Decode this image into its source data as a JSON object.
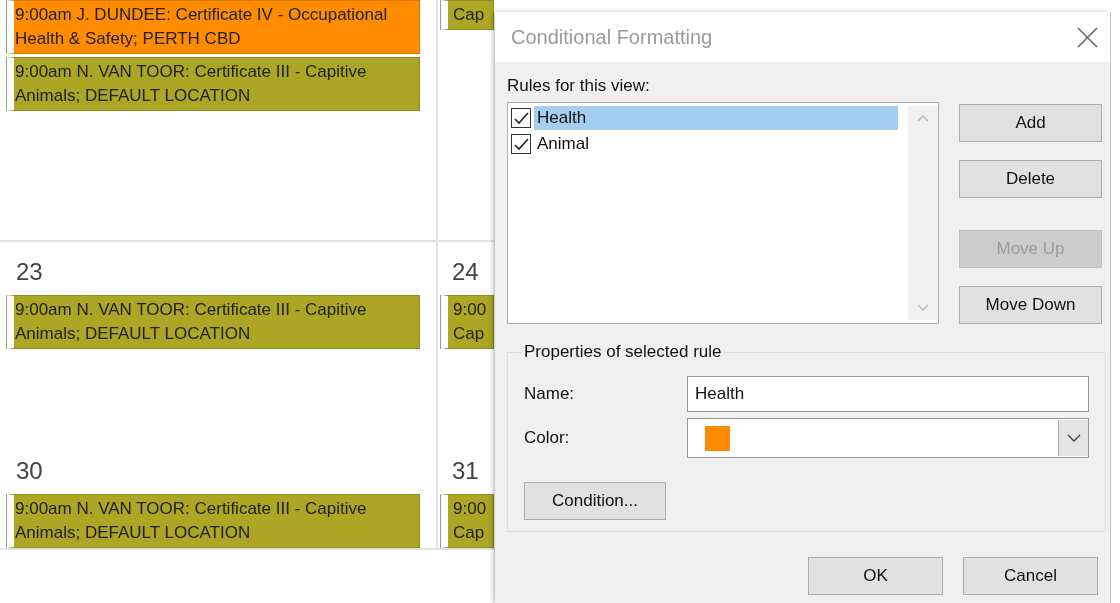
{
  "calendar": {
    "weeks": [
      {
        "days": [
          {
            "events": [
              {
                "text": "9:00am J. DUNDEE: Certificate IV - Occupational Health & Safety; PERTH CBD",
                "color": "#ff8c00"
              },
              {
                "text": "9:00am N. VAN TOOR: Certificate III - Capitive Animals; DEFAULT LOCATION",
                "color": "#aba624"
              }
            ]
          },
          {
            "events": [
              {
                "text": "Cap",
                "color": "#aba624"
              }
            ]
          }
        ]
      },
      {
        "days": [
          {
            "date": "23",
            "events": [
              {
                "text": "9:00am N. VAN TOOR: Certificate III - Capitive Animals; DEFAULT LOCATION",
                "color": "#aba624"
              }
            ]
          },
          {
            "date": "24",
            "events": [
              {
                "text": "9:00 Cap",
                "color": "#aba624"
              }
            ]
          }
        ]
      },
      {
        "days": [
          {
            "date": "30",
            "events": [
              {
                "text": "9:00am N. VAN TOOR: Certificate III - Capitive Animals; DEFAULT LOCATION",
                "color": "#aba624"
              }
            ]
          },
          {
            "date": "31",
            "events": [
              {
                "text": "9:00 Cap",
                "color": "#aba624"
              }
            ]
          }
        ]
      }
    ]
  },
  "dialog": {
    "title": "Conditional Formatting",
    "rules_label": "Rules for this view:",
    "rules": [
      {
        "label": "Health",
        "checked": true,
        "selected": true
      },
      {
        "label": "Animal",
        "checked": true,
        "selected": false
      }
    ],
    "buttons": [
      {
        "label": "Add",
        "disabled": false
      },
      {
        "label": "Delete",
        "disabled": false
      },
      {
        "label": "Move Up",
        "disabled": true
      },
      {
        "label": "Move Down",
        "disabled": false
      }
    ],
    "properties": {
      "legend": "Properties of selected rule",
      "name_label": "Name:",
      "name_value": "Health",
      "color_label": "Color:",
      "color": "#ff8c00",
      "condition_button": "Condition..."
    },
    "footer_buttons": [
      {
        "label": "OK"
      },
      {
        "label": "Cancel"
      }
    ]
  }
}
